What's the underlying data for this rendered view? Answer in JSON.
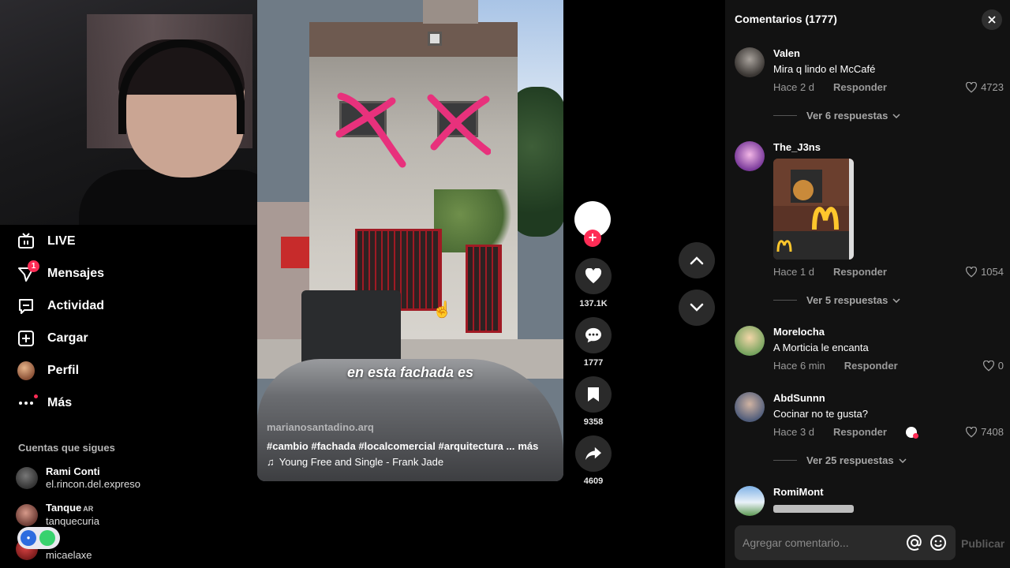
{
  "nav": {
    "items": [
      {
        "label": "LIVE",
        "icon": "live-tv-icon"
      },
      {
        "label": "Mensajes",
        "icon": "message-icon",
        "badge": "1"
      },
      {
        "label": "Actividad",
        "icon": "activity-icon"
      },
      {
        "label": "Cargar",
        "icon": "upload-plus-icon"
      },
      {
        "label": "Perfil",
        "icon": "profile-avatar"
      },
      {
        "label": "Más",
        "icon": "more-dots-icon"
      }
    ],
    "following_title": "Cuentas que sigues",
    "following": [
      {
        "name": "Rami Conti",
        "handle": "el.rincon.del.expreso"
      },
      {
        "name": "Tanque",
        "tag": "AR",
        "handle": "tanquecuria"
      },
      {
        "name": "k",
        "handle": "micaelaxe"
      }
    ]
  },
  "video": {
    "overlay_caption": "en esta fachada es",
    "author": "marianosantadino.arq",
    "hashtags": "#cambio #fachada #localcomercial #arquitectura ...",
    "more_label": "más",
    "music": "Young Free and Single - Frank Jade"
  },
  "actions": {
    "likes": "137.1K",
    "comments": "1777",
    "saves": "9358",
    "shares": "4609"
  },
  "comments_panel": {
    "title": "Comentarios (1777)",
    "reply_label": "Responder",
    "input_placeholder": "Agregar comentario...",
    "publish_label": "Publicar",
    "comments": [
      {
        "user": "Valen",
        "text": "Mira q lindo el McCafé",
        "time": "Hace 2 d",
        "likes": "4723",
        "replies": "Ver 6 respuestas"
      },
      {
        "user": "The_J3ns",
        "text": "",
        "time": "Hace 1 d",
        "likes": "1054",
        "replies": "Ver 5 respuestas"
      },
      {
        "user": "Morelocha",
        "text": "A Morticia le encanta",
        "time": "Hace 6 min",
        "likes": "0"
      },
      {
        "user": "AbdSunnn",
        "text": "Cocinar no te gusta?",
        "time": "Hace 3 d",
        "likes": "7408",
        "replies": "Ver 25 respuestas"
      },
      {
        "user": "RomiMont",
        "text": ""
      }
    ]
  },
  "colors": {
    "accent": "#fe2c55",
    "panel_bg": "#121212",
    "marker_pink": "#e8317c"
  }
}
